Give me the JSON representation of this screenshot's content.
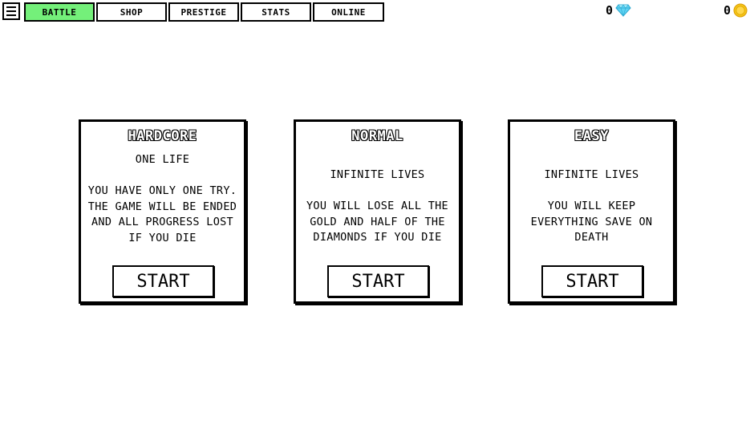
{
  "nav": {
    "tabs": [
      {
        "label": "BATTLE",
        "active": true
      },
      {
        "label": "SHOP",
        "active": false
      },
      {
        "label": "PRESTIGE",
        "active": false
      },
      {
        "label": "STATS",
        "active": false
      },
      {
        "label": "ONLINE",
        "active": false
      }
    ]
  },
  "currency": {
    "diamonds": {
      "value": "0",
      "icon": "diamond-icon"
    },
    "gold": {
      "value": "0",
      "icon": "gold-coin-icon"
    }
  },
  "modes": [
    {
      "title": "HARDCORE",
      "lives": "ONE LIFE",
      "description": "YOU HAVE ONLY ONE TRY. THE GAME WILL BE ENDED AND ALL PROGRESS LOST IF YOU DIE",
      "button": "START"
    },
    {
      "title": "NORMAL",
      "lives": "INFINITE LIVES",
      "description": "YOU WILL LOSE ALL THE GOLD AND HALF OF THE DIAMONDS IF YOU DIE",
      "button": "START"
    },
    {
      "title": "EASY",
      "lives": "INFINITE LIVES",
      "description": "YOU WILL KEEP EVERYTHING SAVE ON DEATH",
      "button": "START"
    }
  ],
  "colors": {
    "active_tab": "#74f07a",
    "diamond": "#5fd3f3",
    "gold": "#f5c518"
  }
}
